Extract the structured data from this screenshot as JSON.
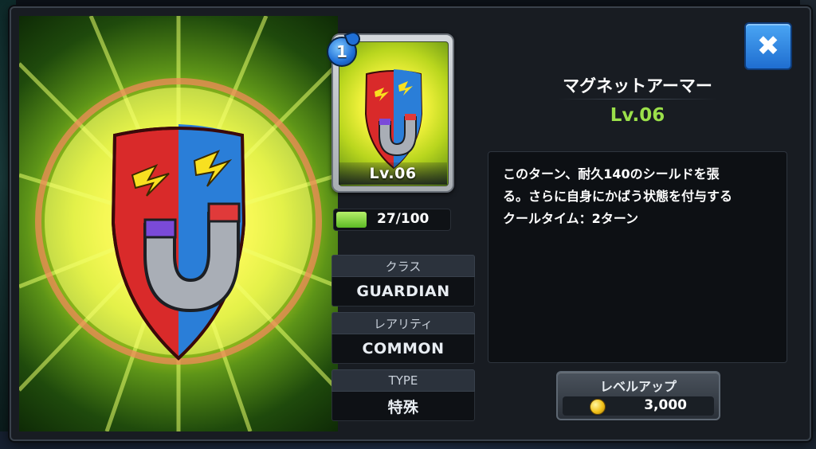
{
  "card": {
    "cost": "1",
    "level_label": "Lv.06",
    "xp_text": "27/100",
    "xp_fraction": 0.27
  },
  "stats": {
    "class_label": "クラス",
    "class_value": "GUARDIAN",
    "rarity_label": "レアリティ",
    "rarity_value": "COMMON",
    "type_label": "TYPE",
    "type_value": "特殊"
  },
  "skill": {
    "name": "マグネットアーマー",
    "level": "Lv.06",
    "description": [
      "このターン、耐久140のシールドを張",
      "る。さらに自身にかばう状態を付与する",
      "クールタイム：2ターン"
    ]
  },
  "buttons": {
    "close_icon": "close-icon",
    "close_glyph": "✖",
    "levelup_label": "レベルアップ",
    "levelup_cost": "3,000",
    "coin_icon": "coin-icon"
  },
  "colors": {
    "level_accent": "#9be04a",
    "close_blue": "#2f86e0",
    "xp_green": "#6cc630"
  }
}
